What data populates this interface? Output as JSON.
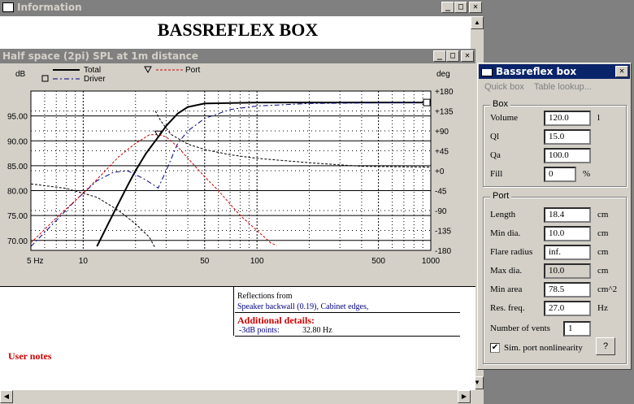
{
  "info_window": {
    "title": "Information",
    "heading": "BASSREFLEX BOX"
  },
  "graph_window": {
    "title": "Half space (2pi) SPL at 1m distance",
    "legend": {
      "total": "Total",
      "driver": "Driver",
      "port": "Port"
    },
    "ylabel_left": "dB",
    "ylabel_right": "deg"
  },
  "chart_data": {
    "type": "line",
    "x_scale": "log",
    "xlim": [
      5,
      1000
    ],
    "x_ticks": [
      "5 Hz",
      "10",
      "50",
      "100",
      "500",
      "1000"
    ],
    "ylim_left": [
      68,
      100
    ],
    "y_ticks_left": [
      "95.00",
      "90.00",
      "85.00",
      "80.00",
      "75.00",
      "70.00"
    ],
    "ylim_right": [
      -180,
      180
    ],
    "y_ticks_right": [
      "+180",
      "+135",
      "+90",
      "+45",
      "+0",
      "-45",
      "-90",
      "-135",
      "-180"
    ],
    "grid": true,
    "series": [
      {
        "name": "Total",
        "axis": "left",
        "style": "solid",
        "color": "#000000",
        "x": [
          12,
          14,
          16,
          18,
          20,
          23,
          26,
          28,
          30,
          35,
          40,
          50,
          70,
          100,
          200,
          400,
          1000
        ],
        "y": [
          68.8,
          73.5,
          77.5,
          81,
          84,
          87.5,
          90,
          91.5,
          93,
          95.5,
          96.8,
          97.5,
          97.6,
          97.7,
          97.7,
          97.7,
          97.7
        ]
      },
      {
        "name": "Driver",
        "axis": "left",
        "style": "dash-dot",
        "color": "#000080",
        "x": [
          5,
          7,
          9,
          12,
          15,
          18,
          22,
          25,
          27,
          30,
          35,
          40,
          50,
          70,
          100,
          200,
          400,
          1000
        ],
        "y": [
          68.8,
          74,
          78,
          82,
          83.7,
          84,
          82.5,
          81.3,
          80.5,
          84,
          89.5,
          92,
          94.5,
          96.3,
          97,
          97.5,
          97.6,
          97.7
        ]
      },
      {
        "name": "Port",
        "axis": "left",
        "style": "dashed",
        "color": "#cc0000",
        "x": [
          5,
          7,
          10,
          13,
          16,
          20,
          24,
          27,
          30,
          35,
          40,
          50,
          60,
          70,
          80,
          100,
          120,
          130
        ],
        "y": [
          69.5,
          74.5,
          79.5,
          83.5,
          86.8,
          89.5,
          91.2,
          91.3,
          90.8,
          88.8,
          86.5,
          82.8,
          80,
          77.3,
          75,
          72,
          69.5,
          69
        ]
      },
      {
        "name": "Driver phase",
        "axis": "right",
        "style": "dashed",
        "color": "#000000",
        "x": [
          5,
          8,
          12,
          16,
          20,
          24,
          26
        ],
        "y": [
          -30,
          -40,
          -60,
          -90,
          -120,
          -150,
          -175
        ]
      },
      {
        "name": "Port phase",
        "axis": "right",
        "style": "dashed",
        "color": "#000000",
        "x": [
          26,
          28,
          32,
          40,
          50,
          70,
          100,
          200,
          400,
          1000
        ],
        "y": [
          135,
          112,
          82,
          60,
          48,
          36,
          28,
          18,
          10,
          8
        ]
      }
    ]
  },
  "details": {
    "reflections_header": "Reflections from",
    "reflections_items": "Speaker backwall (0.19), Cabinet edges,",
    "additional_title": "Additional details:",
    "db_label": "-3dB points:",
    "db_value": "32.80 Hz",
    "user_notes": "User notes"
  },
  "dialog": {
    "title": "Bassreflex box",
    "menu": {
      "quick_box": "Quick box",
      "table_lookup": "Table lookup..."
    },
    "box_group": {
      "label": "Box",
      "volume": {
        "label": "Volume",
        "value": "120.0",
        "unit": "l"
      },
      "ql": {
        "label": "Ql",
        "value": "15.0"
      },
      "qa": {
        "label": "Qa",
        "value": "100.0"
      },
      "fill": {
        "label": "Fill",
        "value": "0",
        "unit": "%"
      }
    },
    "port_group": {
      "label": "Port",
      "length": {
        "label": "Length",
        "value": "18.4",
        "unit": "cm"
      },
      "min_dia": {
        "label": "Min dia.",
        "value": "10.0",
        "unit": "cm"
      },
      "flare_radius": {
        "label": "Flare radius",
        "value": "inf.",
        "unit": "cm"
      },
      "max_dia": {
        "label": "Max dia.",
        "value": "10.0",
        "unit": "cm"
      },
      "min_area": {
        "label": "Min area",
        "value": "78.5",
        "unit": "cm^2"
      },
      "res_freq": {
        "label": "Res. freq.",
        "value": "27.0",
        "unit": "Hz"
      },
      "num_vents": {
        "label": "Number of vents",
        "value": "1"
      },
      "sim_nonlinearity": {
        "label": "Sim. port nonlinearity",
        "checked": true
      },
      "help_button": "?"
    }
  }
}
